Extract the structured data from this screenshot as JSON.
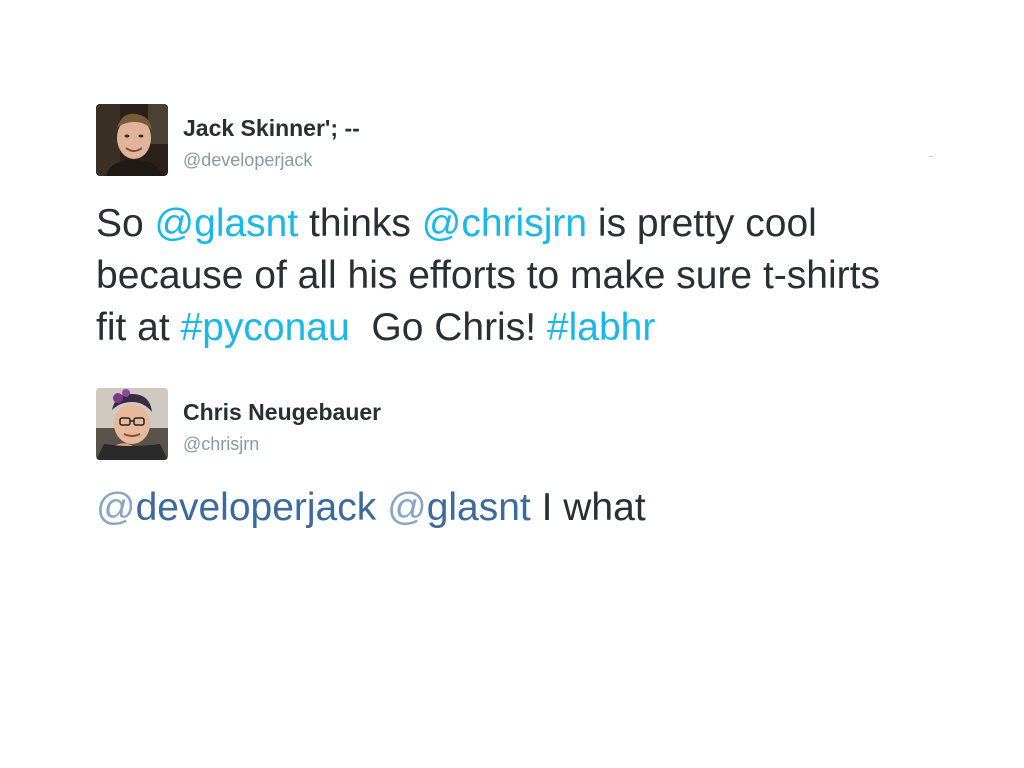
{
  "tweets": [
    {
      "author": {
        "display_name": "Jack Skinner'; --",
        "handle": "@developerjack"
      },
      "segments": [
        {
          "text": "So ",
          "kind": "text"
        },
        {
          "text": "@glasnt",
          "kind": "mention"
        },
        {
          "text": " thinks ",
          "kind": "text"
        },
        {
          "text": "@chrisjrn",
          "kind": "mention"
        },
        {
          "text": " is pretty cool because of all his efforts to make sure t-shirts fit at ",
          "kind": "text"
        },
        {
          "text": "#pyconau",
          "kind": "hashtag"
        },
        {
          "text": "  Go Chris! ",
          "kind": "text"
        },
        {
          "text": "#labhr",
          "kind": "hashtag"
        }
      ]
    },
    {
      "author": {
        "display_name": "Chris Neugebauer",
        "handle": "@chrisjrn"
      },
      "segments": [
        {
          "text": "@developerjack",
          "kind": "mention"
        },
        {
          "text": " ",
          "kind": "text"
        },
        {
          "text": "@glasnt",
          "kind": "mention"
        },
        {
          "text": " I what",
          "kind": "text"
        }
      ]
    }
  ],
  "colors": {
    "name_text": "#292f33",
    "handle_text": "#8899a6",
    "link_bright": "#1ab8e8",
    "link_dark": "#3c6a9e"
  },
  "icons": [
    "avatar-jack",
    "avatar-chris"
  ]
}
